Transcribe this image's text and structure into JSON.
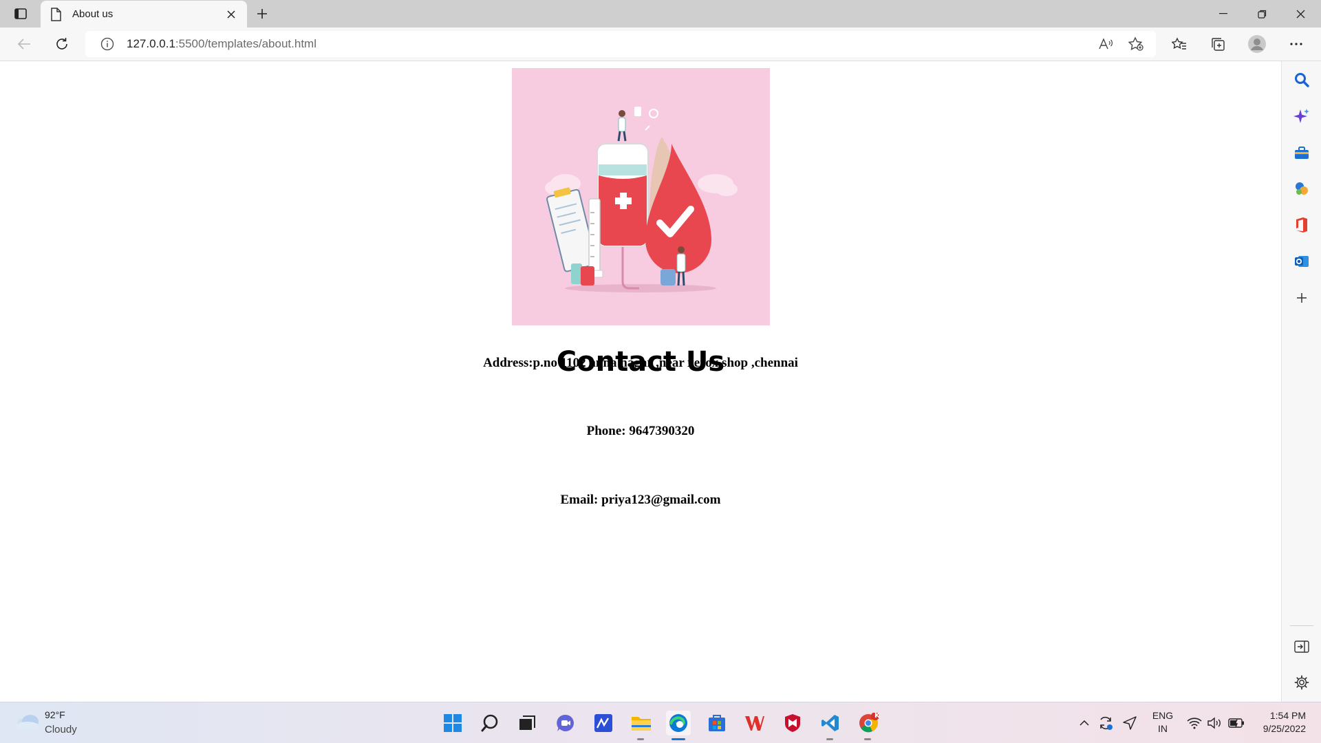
{
  "browser": {
    "tab": {
      "title": "About us"
    },
    "address": {
      "host": "127.0.0.1",
      "path": ":5500/templates/about.html"
    }
  },
  "page": {
    "heading": "Contact Us",
    "address": "Address:p.no 1102 anna nagar ,near xerox shop ,chennai",
    "phone": "Phone: 9647390320",
    "email": "Email: priya123@gmail.com"
  },
  "taskbar": {
    "weather": {
      "temperature": "92°F",
      "condition": "Cloudy"
    },
    "language": {
      "line1": "ENG",
      "line2": "IN"
    },
    "clock": {
      "time": "1:54 PM",
      "date": "9/25/2022"
    },
    "chrome_badge": "K"
  },
  "colors": {
    "hero_background": "#f7cce0",
    "blood_red": "#e8474f",
    "edge_blue": "#0c79d8"
  }
}
